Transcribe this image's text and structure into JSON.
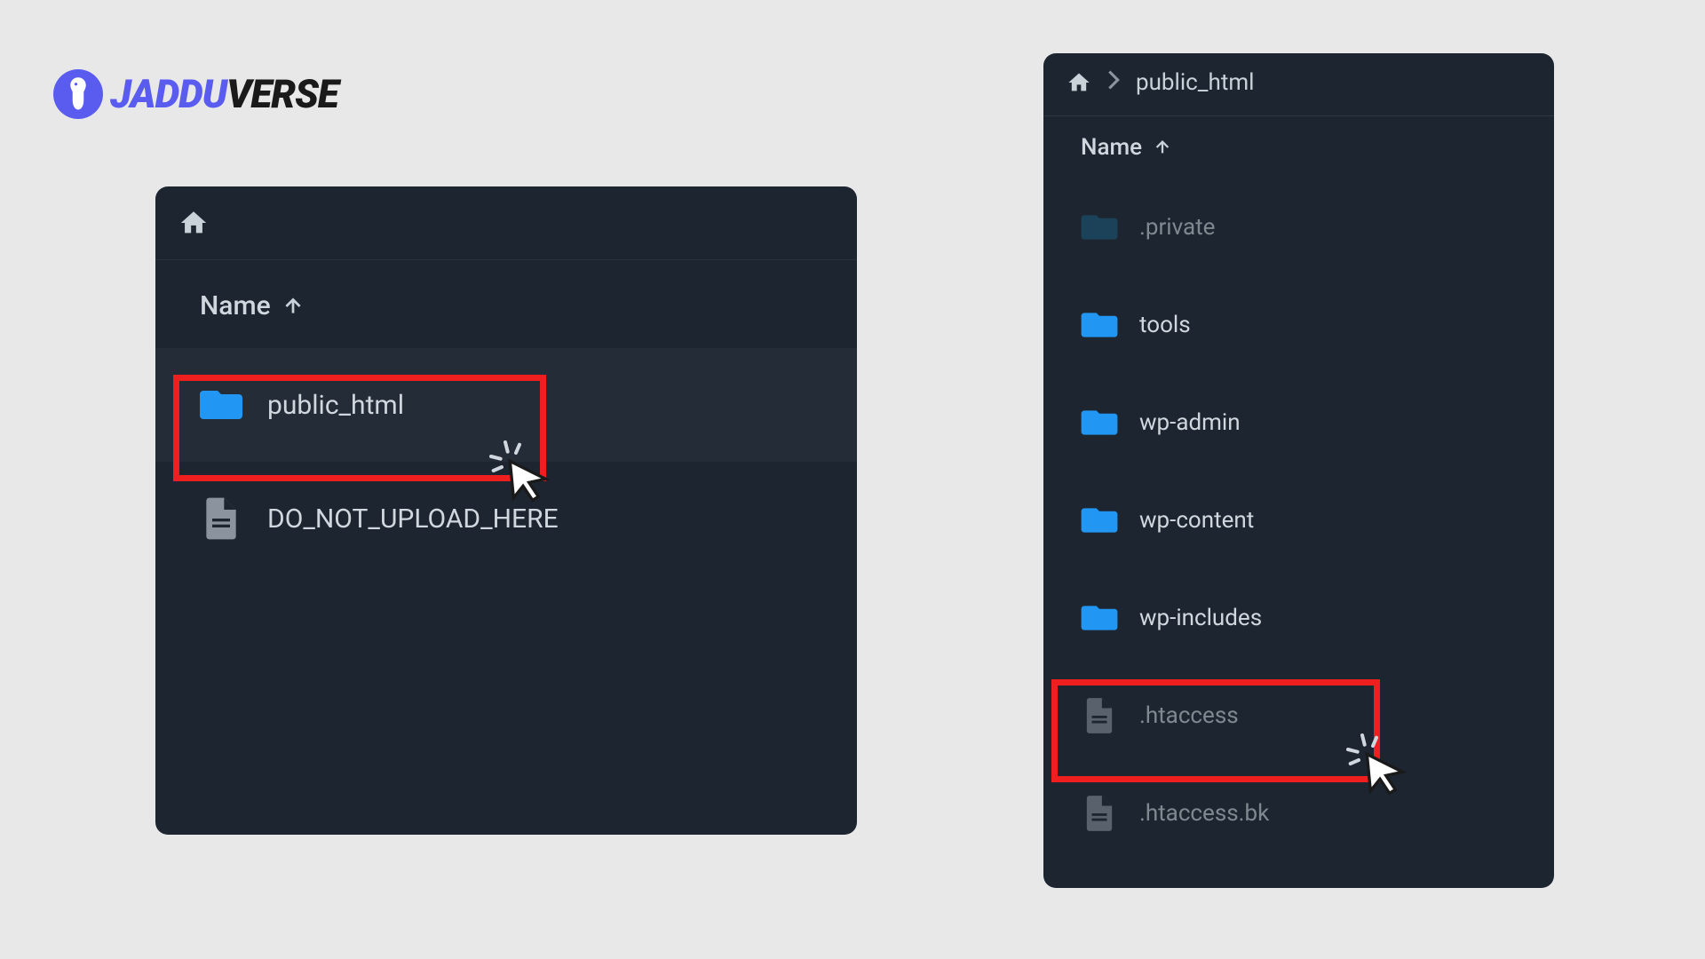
{
  "logo": {
    "part1": "JADDU",
    "part2": "VERSE"
  },
  "leftPanel": {
    "columnHeader": "Name",
    "rows": [
      {
        "type": "folder",
        "label": "public_html",
        "highlighted": true,
        "hover": true
      },
      {
        "type": "file",
        "label": "DO_NOT_UPLOAD_HERE"
      }
    ]
  },
  "rightPanel": {
    "breadcrumb": "public_html",
    "columnHeader": "Name",
    "rows": [
      {
        "type": "folder",
        "label": ".private",
        "dim": true,
        "folderColor": "#1a5a7a"
      },
      {
        "type": "folder",
        "label": "tools"
      },
      {
        "type": "folder",
        "label": "wp-admin"
      },
      {
        "type": "folder",
        "label": "wp-content"
      },
      {
        "type": "folder",
        "label": "wp-includes"
      },
      {
        "type": "file",
        "label": ".htaccess",
        "dim": true,
        "highlighted": true
      },
      {
        "type": "file",
        "label": ".htaccess.bk",
        "dim": true
      }
    ]
  },
  "colors": {
    "folder": "#2196f3",
    "file": "#8b949e",
    "highlight": "#ef1f1f"
  }
}
